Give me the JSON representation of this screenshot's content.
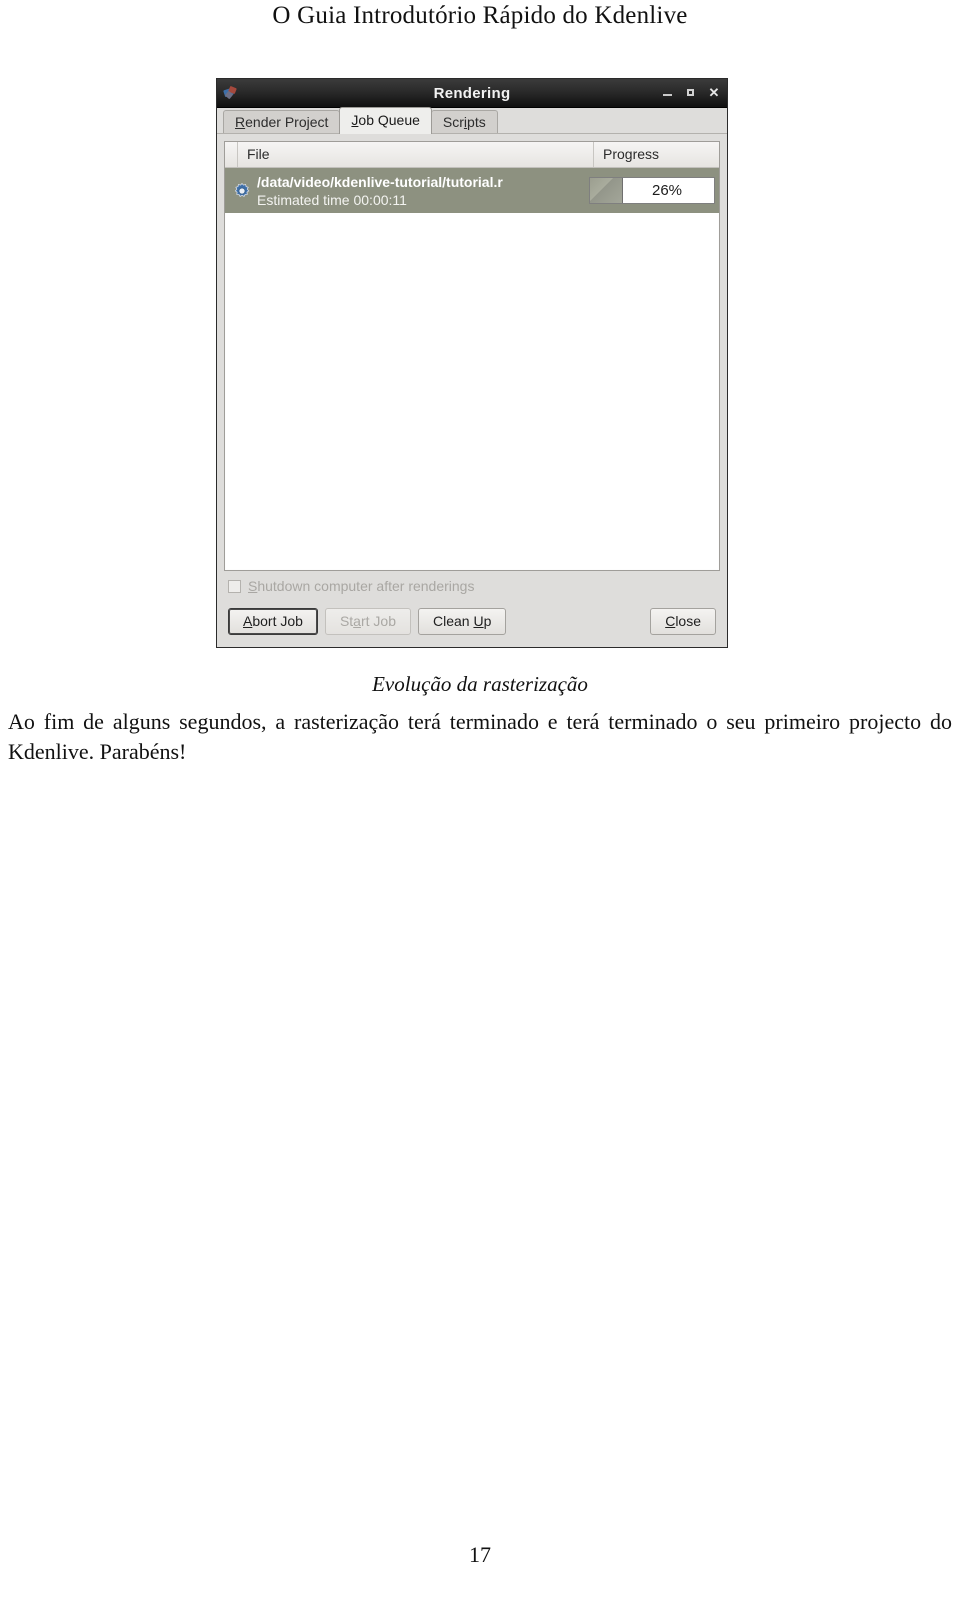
{
  "document": {
    "header": "O Guia Introdutório Rápido do Kdenlive",
    "caption": "Evolução da rasterização",
    "body": "Ao fim de alguns segundos, a rasterização terá terminado e terá terminado o seu primeiro projecto do Kdenlive. Parabéns!",
    "page_number": "17"
  },
  "dialog": {
    "title": "Rendering",
    "window_icon": "kdenlive-icon",
    "window_controls": {
      "minimize": "minimize-icon",
      "maximize": "maximize-icon",
      "close": "✕"
    },
    "tabs": [
      {
        "label": "Render Project",
        "accel": "R",
        "rest": "ender Project",
        "active": false
      },
      {
        "label": "Job Queue",
        "accel": "J",
        "rest": "ob Queue",
        "active": true
      },
      {
        "label": "Scripts",
        "pre": "Scr",
        "accel": "i",
        "rest": "pts",
        "active": false
      }
    ],
    "list": {
      "columns": [
        {
          "key": "file",
          "label": "File"
        },
        {
          "key": "progress",
          "label": "Progress"
        }
      ],
      "rows": [
        {
          "status_icon": "gear-icon",
          "file_path": "/data/video/kdenlive-tutorial/tutorial.r",
          "estimated_time": "Estimated time 00:00:11",
          "progress_percent": 26,
          "progress_label": "26%",
          "selected": true
        }
      ]
    },
    "shutdown_option": {
      "label": "Shutdown computer after renderings",
      "accel": "S",
      "rest": "hutdown computer after renderings",
      "checked": false,
      "enabled": false
    },
    "buttons": [
      {
        "label": "Abort Job",
        "accel": "A",
        "rest": "bort Job",
        "state": "focused"
      },
      {
        "label": "Start Job",
        "pre": "St",
        "accel": "a",
        "rest": "rt Job",
        "state": "disabled"
      },
      {
        "label": "Clean Up",
        "pre": "Clean ",
        "accel": "U",
        "rest": "p",
        "state": "normal"
      },
      {
        "label": "Close",
        "pre": "",
        "accel": "C",
        "rest": "lose",
        "state": "normal"
      }
    ],
    "colors": {
      "titlebar": "#1a1a1a",
      "dialog_bg": "#dedddb",
      "selection": "#8d9180",
      "list_bg": "#ffffff"
    }
  }
}
